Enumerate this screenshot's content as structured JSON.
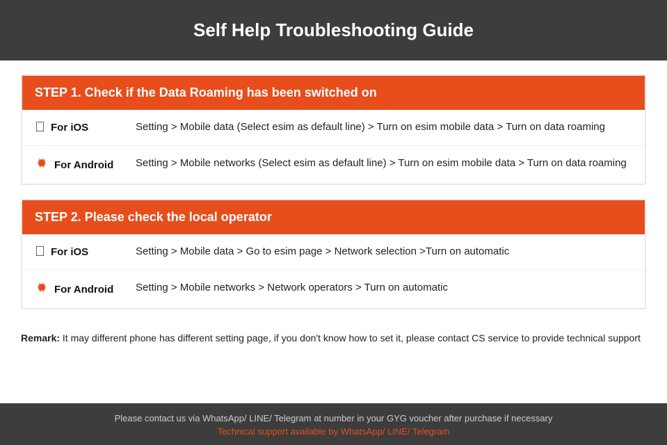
{
  "header": {
    "title": "Self Help Troubleshooting Guide"
  },
  "step1": {
    "heading": "STEP 1.  Check if the Data Roaming has been switched on",
    "ios_label": "For iOS",
    "ios_text": "Setting > Mobile data (Select esim as default line) > Turn on esim mobile data > Turn on data roaming",
    "android_label": "For Android",
    "android_text": "Setting > Mobile networks (Select esim as default line) > Turn on esim mobile data > Turn on data roaming"
  },
  "step2": {
    "heading": "STEP 2.  Please check the local operator",
    "ios_label": "For iOS",
    "ios_text": "Setting > Mobile data > Go to esim page > Network selection >Turn on automatic",
    "android_label": "For Android",
    "android_text": "Setting > Mobile networks > Network operators > Turn on automatic"
  },
  "remark": {
    "bold_text": "Remark:",
    "text": " It may different phone has different setting page, if you don't know how to set it,  please contact CS service to provide technical support"
  },
  "footer": {
    "contact_text": "Please contact us via WhatsApp/ LINE/ Telegram at number in your GYG voucher after purchase if necessary",
    "support_text": "Technical support available by WhatsApp/ LINE/ Telegram"
  }
}
